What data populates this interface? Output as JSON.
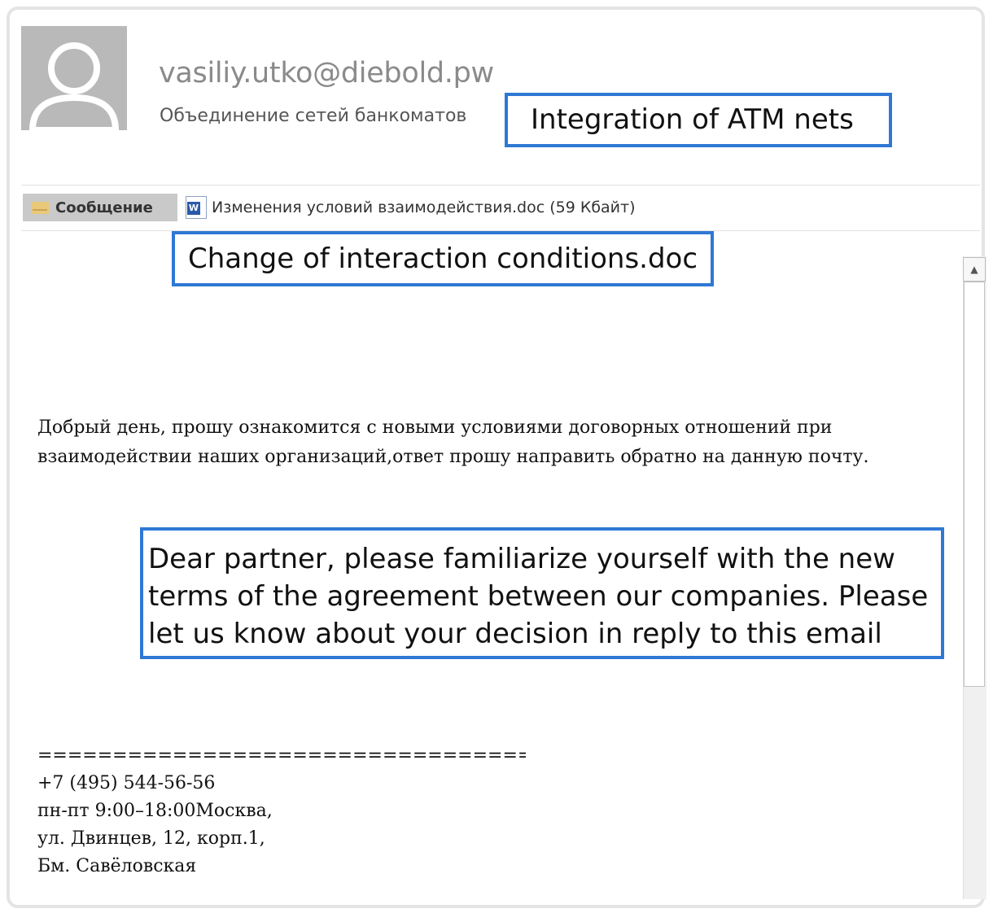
{
  "email": {
    "sender": "vasiliy.utko@diebold.pw",
    "subject": "Объединение сетей банкоматов",
    "tabs": {
      "message_label": "Сообщение",
      "attachment_label": "Изменения условий взаимодействия.doc (59 Кбайт)"
    },
    "body_text": "Добрый день, прошу ознакомится с новыми условиями договорных отношений при взаимодействии наших организаций,ответ прошу направить обратно на данную почту.",
    "signature": {
      "separator": "===================================",
      "phone": "+7 (495) 544-56-56",
      "hours": "пн-пт 9:00–18:00Москва,",
      "address": "ул. Двинцев, 12, корп.1,",
      "metro": "Бм. Савёловская"
    }
  },
  "annotations": {
    "subject_translation": "Integration of ATM nets",
    "attachment_translation": "Change of interaction conditions.doc",
    "body_translation": "Dear partner, please familiarize yourself with the new terms of the agreement between our companies. Please let us know about your decision in reply to this email"
  },
  "icons": {
    "avatar": "default-user-avatar",
    "message_tab": "envelope-icon",
    "attachment": "word-document-icon",
    "scroll_up": "scroll-up-arrow-icon"
  },
  "colors": {
    "callout_border": "#2f78d4",
    "avatar_bg": "#b9b9b9",
    "sender_text": "#8a8a8a"
  }
}
